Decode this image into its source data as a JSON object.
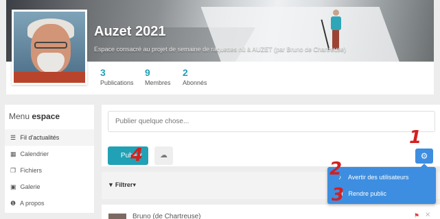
{
  "header": {
    "title": "Auzet 2021",
    "subtitle": "Espace consacré au projet de semaine de raquettes nù à AUZET (par Bruno de Chartreuse)"
  },
  "stats": [
    {
      "value": "3",
      "label": "Publications"
    },
    {
      "value": "9",
      "label": "Membres"
    },
    {
      "value": "2",
      "label": "Abonnés"
    }
  ],
  "menu": {
    "title_prefix": "Menu ",
    "title_bold": "espace",
    "items": [
      {
        "icon": "list-icon",
        "glyph": "☰",
        "label": "Fil d'actualités"
      },
      {
        "icon": "calendar-icon",
        "glyph": "▦",
        "label": "Calendrier"
      },
      {
        "icon": "files-icon",
        "glyph": "❐",
        "label": "Fichiers"
      },
      {
        "icon": "image-icon",
        "glyph": "▣",
        "label": "Galerie"
      },
      {
        "icon": "info-icon",
        "glyph": "❶",
        "label": "A propos"
      }
    ]
  },
  "composer": {
    "placeholder": "Publier quelque chose...",
    "publish_label": "Publier",
    "upload_glyph": "☁"
  },
  "filter": {
    "label": "Filtrer"
  },
  "dropdown": {
    "items": [
      {
        "icon": "bell-icon",
        "glyph": "🔔",
        "label": "Avertir des utilisateurs"
      },
      {
        "icon": "unlock-icon",
        "glyph": "🔓",
        "label": "Rendre public"
      }
    ]
  },
  "next_post": {
    "author": "Bruno (de Chartreuse)"
  },
  "annotations": [
    "1",
    "2",
    "3",
    "4"
  ]
}
